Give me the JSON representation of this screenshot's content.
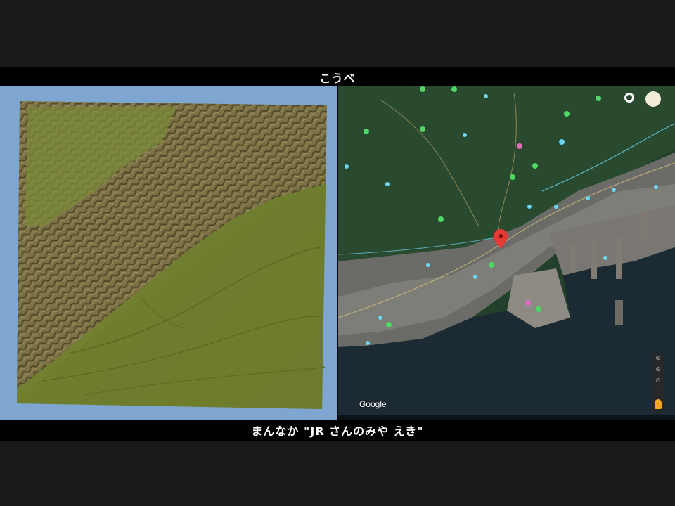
{
  "video": {
    "top_caption": "こうべ",
    "bottom_caption": "まんなか \"JR さんのみや えき\""
  },
  "map": {
    "attribution_logo": "Google",
    "pin_color": "#e53935",
    "icons": [
      "location-pin-icon",
      "settings-icon",
      "profile-icon",
      "zoom-in-icon",
      "zoom-out-icon",
      "pegman-icon"
    ]
  },
  "colors": {
    "terrain_frame": "#7ea6d1",
    "terrain_plain": "#6f7d2e",
    "terrain_mountain": "#7a6a45",
    "sea": "#1c2a33",
    "forest": "#24402a"
  }
}
